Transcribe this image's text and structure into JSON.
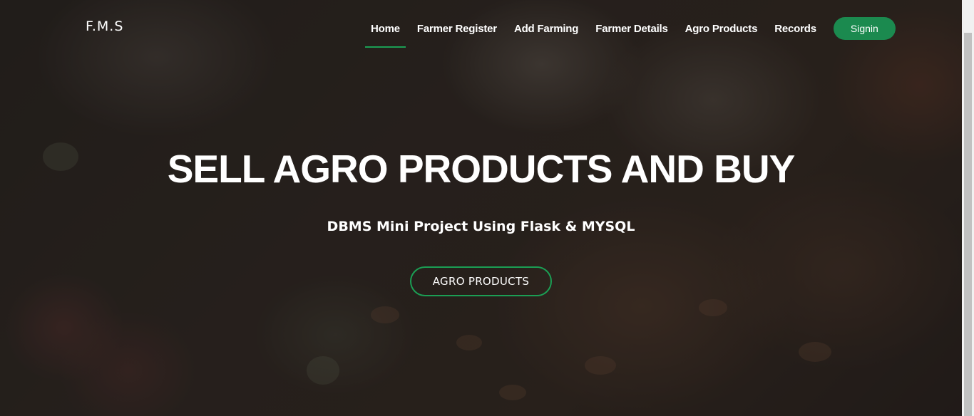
{
  "brand": "F.M.S",
  "nav": {
    "items": [
      {
        "label": "Home",
        "active": true
      },
      {
        "label": "Farmer Register"
      },
      {
        "label": "Add Farming"
      },
      {
        "label": "Farmer Details"
      },
      {
        "label": "Agro Products"
      },
      {
        "label": "Records"
      }
    ],
    "signin_label": "Signin"
  },
  "hero": {
    "title": "SELL AGRO PRODUCTS AND BUY",
    "subtitle": "DBMS Mini Project Using Flask & MYSQL",
    "button_label": "AGRO PRODUCTS"
  },
  "colors": {
    "accent": "#1b8a4f",
    "accent_border": "#1b9e54",
    "text": "#ffffff"
  }
}
